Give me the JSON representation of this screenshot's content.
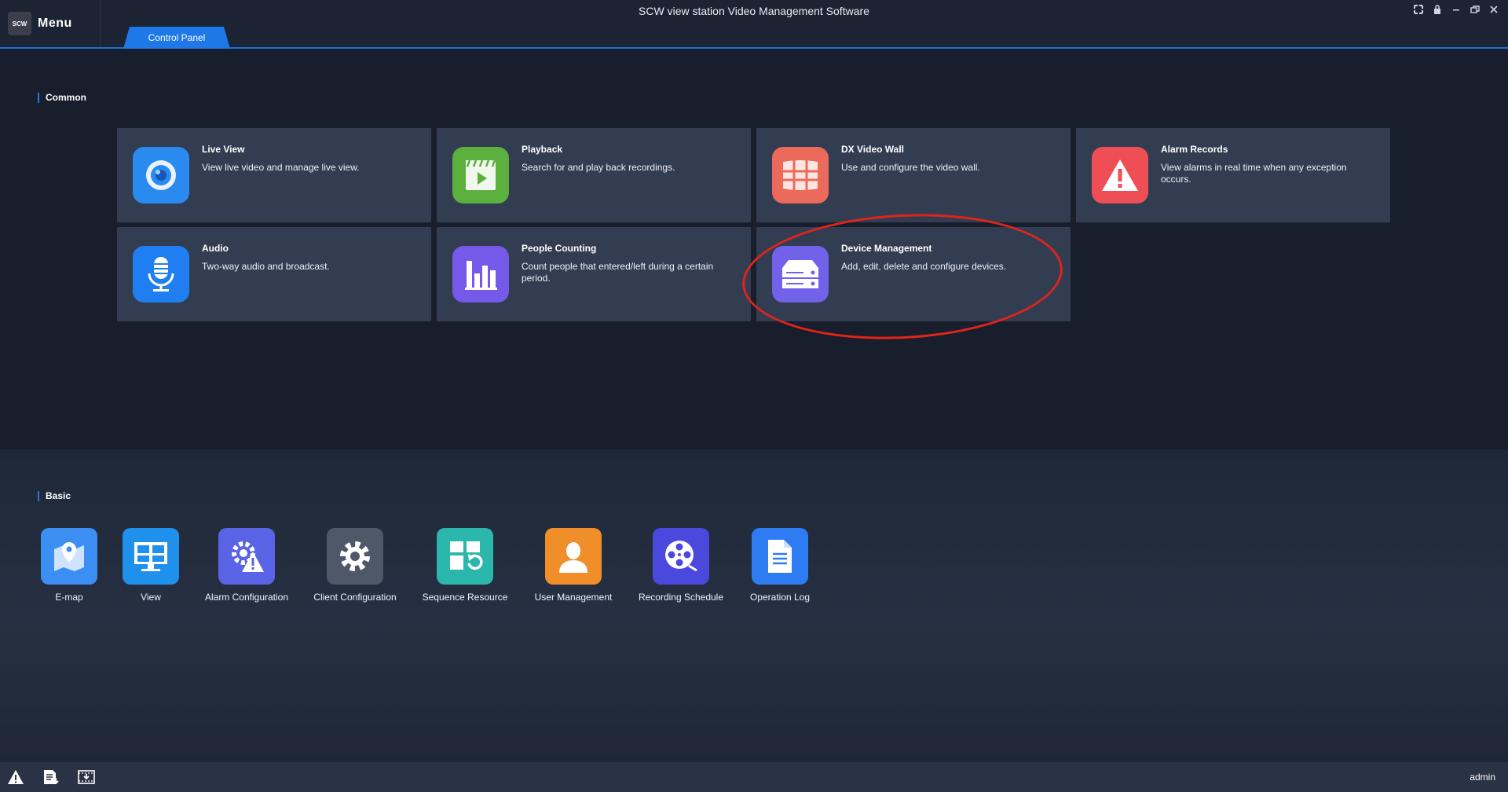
{
  "titlebar": {
    "logo_text": "SCW",
    "menu_label": "Menu",
    "app_title": "SCW view station Video Management Software",
    "tab_label": "Control Panel"
  },
  "sections": {
    "common_title": "Common",
    "basic_title": "Basic"
  },
  "common_cards": [
    {
      "title": "Live View",
      "desc": "View live video and manage live view.",
      "icon": "live-view-icon",
      "color": "#2b8af0"
    },
    {
      "title": "Playback",
      "desc": "Search for and play back recordings.",
      "icon": "playback-icon",
      "color": "#5cb03e"
    },
    {
      "title": "DX Video Wall",
      "desc": "Use and configure the video wall.",
      "icon": "video-wall-icon",
      "color": "#ec6a5a"
    },
    {
      "title": "Alarm Records",
      "desc": "View alarms in real time when any exception occurs.",
      "icon": "alarm-icon",
      "color": "#ef4e54"
    },
    {
      "title": "Audio",
      "desc": "Two-way audio and broadcast.",
      "icon": "microphone-icon",
      "color": "#1f7ef2"
    },
    {
      "title": "People Counting",
      "desc": "Count people that entered/left during a certain period.",
      "icon": "bar-chart-icon",
      "color": "#7559e8"
    },
    {
      "title": "Device Management",
      "desc": "Add, edit, delete and configure devices.",
      "icon": "device-icon",
      "color": "#7262ea"
    }
  ],
  "basic_tools": [
    {
      "label": "E-map",
      "icon": "map-pin-icon",
      "color": "#3b8ff2"
    },
    {
      "label": "View",
      "icon": "monitor-icon",
      "color": "#1f90ec"
    },
    {
      "label": "Alarm Configuration",
      "icon": "alarm-config-icon",
      "color": "#5963e6"
    },
    {
      "label": "Client Configuration",
      "icon": "gear-icon",
      "color": "#4f5868"
    },
    {
      "label": "Sequence Resource",
      "icon": "sequence-icon",
      "color": "#2bb7ac"
    },
    {
      "label": "User Management",
      "icon": "user-icon",
      "color": "#f08e2a"
    },
    {
      "label": "Recording Schedule",
      "icon": "film-reel-icon",
      "color": "#4a48dd"
    },
    {
      "label": "Operation Log",
      "icon": "document-icon",
      "color": "#2e7cf2"
    }
  ],
  "statusbar": {
    "user": "admin"
  }
}
